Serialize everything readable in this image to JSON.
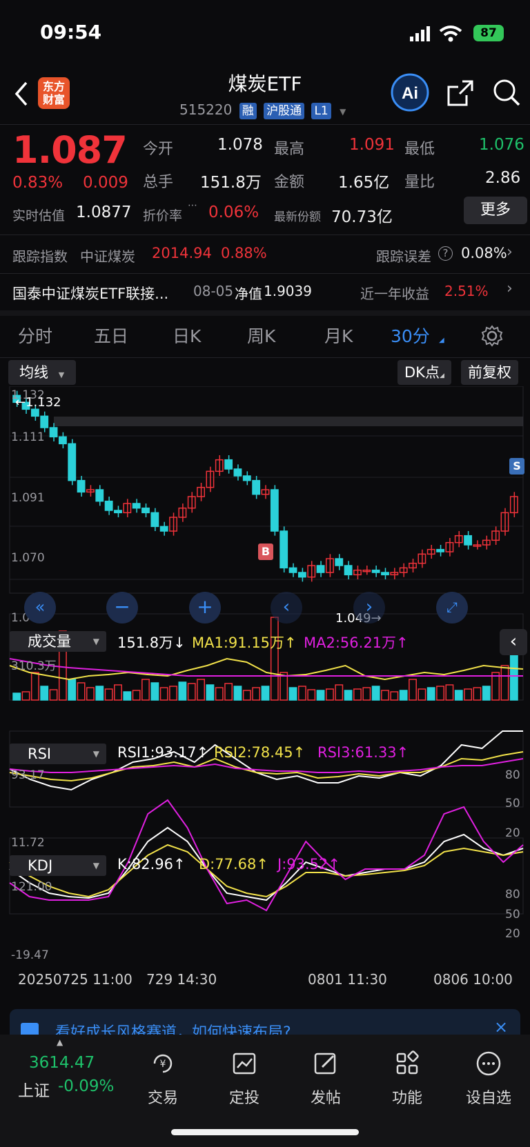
{
  "status": {
    "time": "09:54",
    "battery": "87"
  },
  "header": {
    "title": "煤炭ETF",
    "code": "515220",
    "tags": [
      "融",
      "沪股通",
      "L1"
    ],
    "logo": "东方财富"
  },
  "quote": {
    "price": "1.087",
    "change_pct": "0.83%",
    "change": "0.009",
    "open_label": "今开",
    "open": "1.078",
    "high_label": "最高",
    "high": "1.091",
    "low_label": "最低",
    "low": "1.076",
    "volume_label": "总手",
    "volume": "151.8万",
    "amount_label": "金额",
    "amount": "1.65亿",
    "vol_ratio_label": "量比",
    "vol_ratio": "2.86",
    "est_label": "实时估值",
    "est": "1.0877",
    "premium_label": "折价率",
    "premium": "0.06%",
    "shares_label": "最新份额",
    "shares": "70.73亿",
    "more": "更多"
  },
  "tracking": {
    "index_label": "跟踪指数",
    "index_name": "中证煤炭",
    "index_value": "2014.94",
    "index_pct": "0.88%",
    "error_label": "跟踪误差",
    "error_value": "0.08%"
  },
  "fund": {
    "name": "国泰中证煤炭ETF联接...",
    "date": "08-05",
    "nav_label": "净值",
    "nav": "1.9039",
    "return_label": "近一年收益",
    "return": "2.51%"
  },
  "tabs": [
    "分时",
    "五日",
    "日K",
    "周K",
    "月K",
    "30分"
  ],
  "chart_toolbar": {
    "ma": "均线",
    "dk": "DK点",
    "adjust": "前复权"
  },
  "kline": {
    "y_ticks": [
      "1.132",
      "1.111",
      "1.091",
      "1.070",
      "1.049"
    ],
    "max_label": "1.132",
    "min_label": "1.049",
    "buy_marker": "B",
    "sell_marker": "S"
  },
  "volume": {
    "name": "成交量",
    "value": "151.8万",
    "ma1": "MA1:91.15万",
    "ma2": "MA2:56.21万",
    "ymax": "310.3万"
  },
  "rsi": {
    "name": "RSI",
    "rsi1": "RSI1:93.17",
    "rsi2": "RSI2:78.45",
    "rsi3": "RSI3:61.33",
    "ymax": "93.17",
    "ymin": "11.72",
    "levels": [
      "80",
      "50",
      "20"
    ]
  },
  "kdj": {
    "name": "KDJ",
    "k": "K:82.96",
    "d": "D:77.68",
    "j": "J:93.52",
    "ymax": "121.00",
    "ymin": "-19.47",
    "levels": [
      "80",
      "50",
      "20"
    ]
  },
  "x_axis": [
    "20250725 11:00",
    "729 14:30",
    "0801 11:30",
    "0806 10:00"
  ],
  "banner": {
    "text": "看好成长风格赛道，如何快速布局?"
  },
  "bottom": {
    "index_value": "3614.47",
    "index_name": "上证",
    "index_pct": "-0.09%",
    "items": [
      "交易",
      "定投",
      "发帖",
      "功能",
      "设自选"
    ]
  },
  "colors": {
    "up": "#f0333a",
    "down": "#2bd1d9",
    "accent": "#3a8ef6",
    "ma1": "#f2e24a",
    "ma2": "#e020e0"
  }
}
